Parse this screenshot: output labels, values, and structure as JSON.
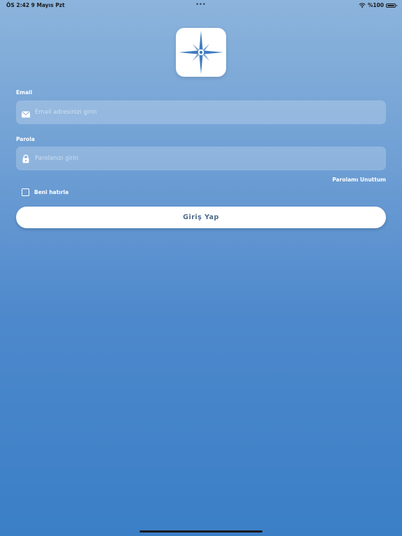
{
  "status_bar": {
    "time_date": "ÖS 2:42   9 Mayıs Pzt",
    "battery": "%100"
  },
  "icons": {
    "app_logo": "compass-star-icon",
    "email": "envelope-icon",
    "password": "lock-icon",
    "wifi": "wifi-icon",
    "battery": "battery-icon"
  },
  "colors": {
    "gradient_top": "#8cb4dc",
    "gradient_bottom": "#3b7fc6",
    "logo_blue": "#3f7cc0",
    "button_text": "#4a6a8a"
  },
  "form": {
    "email_label": "Email",
    "email_placeholder": "Email adresinizi girin",
    "email_value": "",
    "password_label": "Parola",
    "password_placeholder": "Parolanızı girin",
    "password_value": "",
    "forgot_password": "Parolamı Unuttum",
    "remember_me": "Beni hatırla",
    "remember_checked": false,
    "submit_label": "Giriş Yap"
  }
}
